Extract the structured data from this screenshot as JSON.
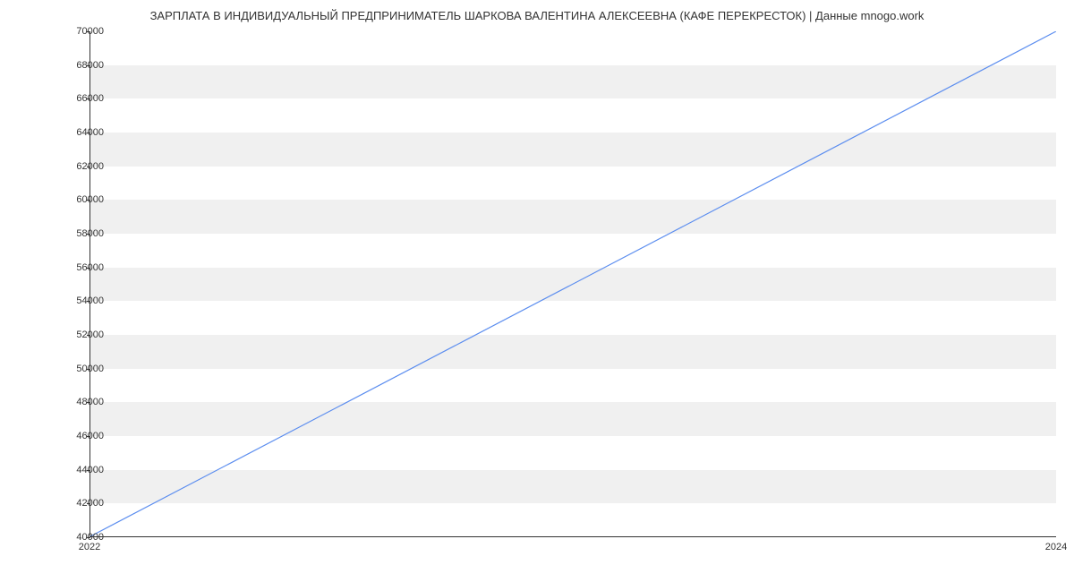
{
  "chart_data": {
    "type": "line",
    "title": "ЗАРПЛАТА В ИНДИВИДУАЛЬНЫЙ ПРЕДПРИНИМАТЕЛЬ ШАРКОВА ВАЛЕНТИНА АЛЕКСЕЕВНА (КАФЕ ПЕРЕКРЕСТОК) | Данные mnogo.work",
    "x": [
      2022,
      2024
    ],
    "values": [
      40000,
      70000
    ],
    "xlabel": "",
    "ylabel": "",
    "xlim": [
      2022,
      2024
    ],
    "ylim": [
      40000,
      70000
    ],
    "x_ticks": [
      2022,
      2024
    ],
    "y_ticks": [
      40000,
      42000,
      44000,
      46000,
      48000,
      50000,
      52000,
      54000,
      56000,
      58000,
      60000,
      62000,
      64000,
      66000,
      68000,
      70000
    ],
    "line_color": "#5b8def"
  }
}
